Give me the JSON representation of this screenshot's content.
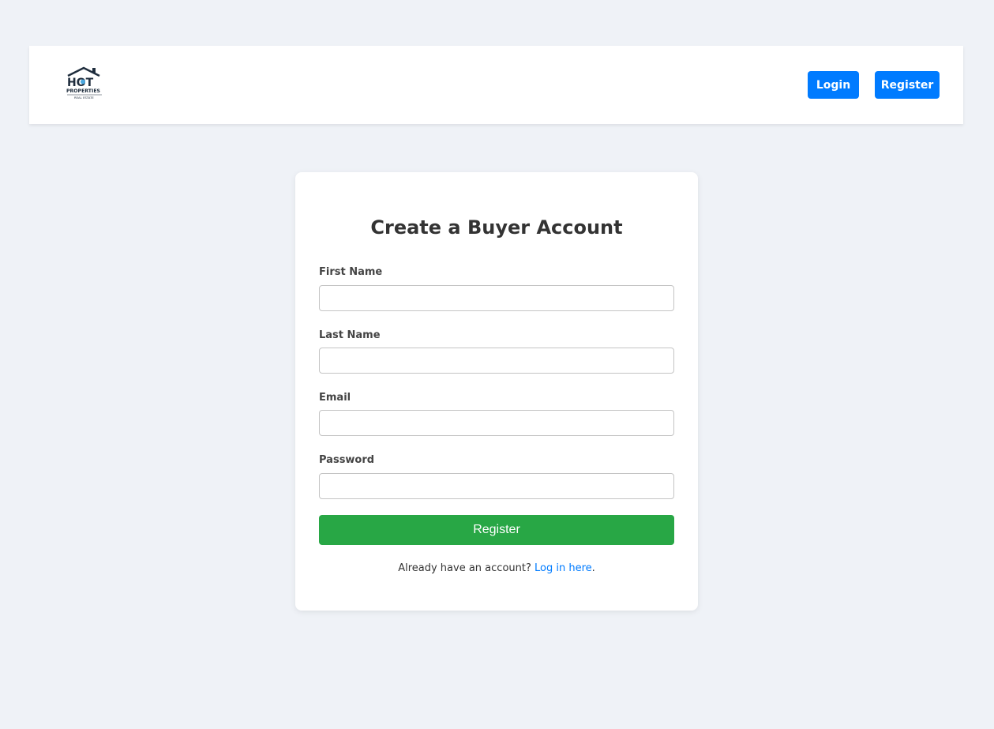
{
  "header": {
    "logo": {
      "line1": "HOT",
      "line2": "PROPERTIES",
      "line3": "REAL ESTATE"
    },
    "nav": {
      "login_label": "Login",
      "register_label": "Register"
    }
  },
  "form": {
    "title": "Create a Buyer Account",
    "fields": [
      {
        "label": "First Name",
        "value": "",
        "placeholder": ""
      },
      {
        "label": "Last Name",
        "value": "",
        "placeholder": ""
      },
      {
        "label": "Email",
        "value": "",
        "placeholder": ""
      },
      {
        "label": "Password",
        "value": "",
        "placeholder": ""
      }
    ],
    "submit_label": "Register",
    "footer": {
      "prefix": "Already have an account? ",
      "link_text": "Log in here",
      "suffix": "."
    }
  },
  "colors": {
    "primary": "#007bff",
    "success": "#28a745",
    "background": "#eff2f7"
  }
}
